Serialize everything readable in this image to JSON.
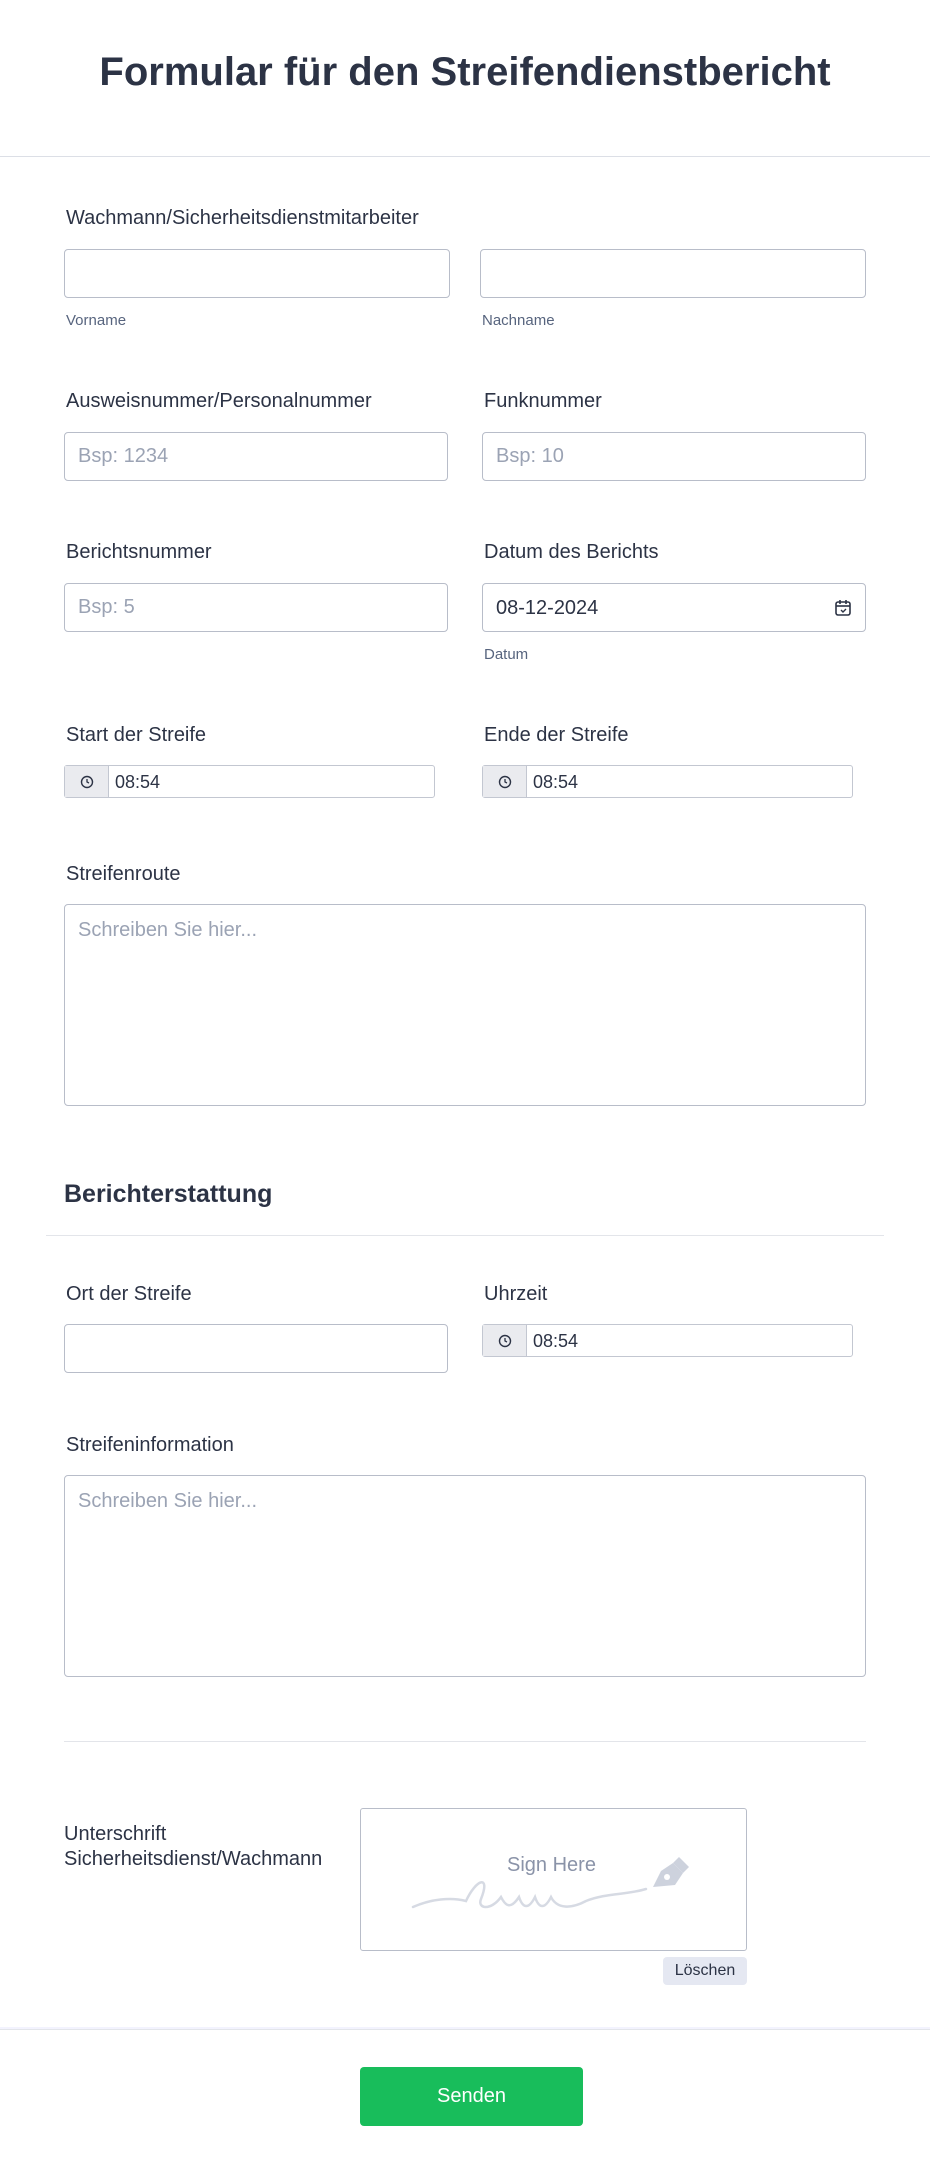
{
  "header": {
    "title": "Formular für den Streifendienstbericht"
  },
  "guard": {
    "label": "Wachmann/Sicherheitsdienstmitarbeiter",
    "first_sublabel": "Vorname",
    "last_sublabel": "Nachname",
    "first_value": "",
    "last_value": ""
  },
  "badge": {
    "label": "Ausweisnummer/Personalnummer",
    "placeholder": "Bsp: 1234"
  },
  "radio": {
    "label": "Funknummer",
    "placeholder": "Bsp: 10"
  },
  "report_number": {
    "label": "Berichtsnummer",
    "placeholder": "Bsp: 5"
  },
  "report_date": {
    "label": "Datum des Berichts",
    "value": "08-12-2024",
    "sublabel": "Datum",
    "icon": "calendar-icon"
  },
  "patrol_start": {
    "label": "Start der Streife",
    "value": "08:54",
    "icon": "clock-icon"
  },
  "patrol_end": {
    "label": "Ende der Streife",
    "value": "08:54",
    "icon": "clock-icon"
  },
  "route": {
    "label": "Streifenroute",
    "placeholder": "Schreiben Sie hier..."
  },
  "reporting": {
    "title": "Berichterstattung"
  },
  "location": {
    "label": "Ort der Streife",
    "value": ""
  },
  "time": {
    "label": "Uhrzeit",
    "value": "08:54",
    "icon": "clock-icon"
  },
  "info": {
    "label": "Streifeninformation",
    "placeholder": "Schreiben Sie hier..."
  },
  "signature": {
    "label_line1": "Unterschrift",
    "label_line2": "Sicherheitsdienst/Wachmann",
    "prompt": "Sign Here",
    "clear_label": "Löschen",
    "icon": "pen-icon"
  },
  "submit": {
    "label": "Senden"
  },
  "colors": {
    "submit": "#18bd5b",
    "text": "#2c3345",
    "background": "#f3f3fe",
    "border": "#b8bdc9"
  }
}
